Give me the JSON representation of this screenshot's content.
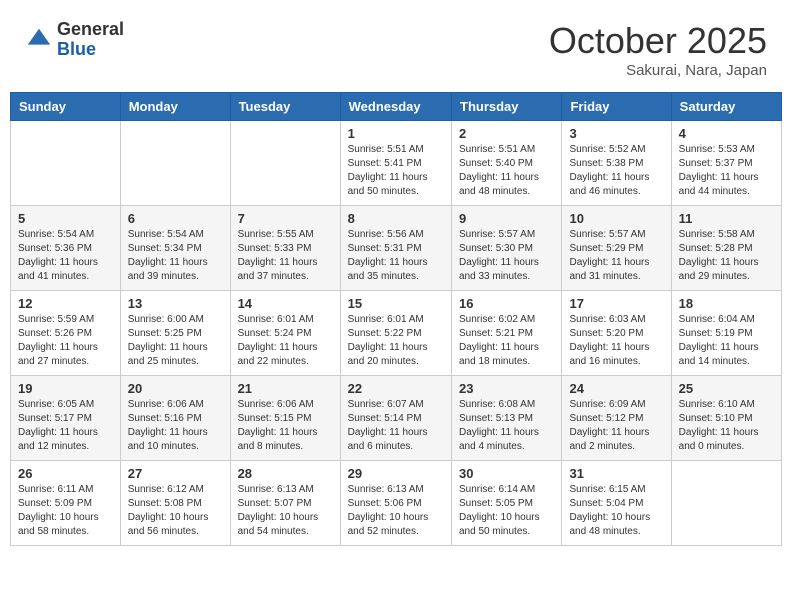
{
  "header": {
    "logo_general": "General",
    "logo_blue": "Blue",
    "month": "October 2025",
    "location": "Sakurai, Nara, Japan"
  },
  "days_of_week": [
    "Sunday",
    "Monday",
    "Tuesday",
    "Wednesday",
    "Thursday",
    "Friday",
    "Saturday"
  ],
  "weeks": [
    [
      {
        "day": "",
        "info": ""
      },
      {
        "day": "",
        "info": ""
      },
      {
        "day": "",
        "info": ""
      },
      {
        "day": "1",
        "info": "Sunrise: 5:51 AM\nSunset: 5:41 PM\nDaylight: 11 hours\nand 50 minutes."
      },
      {
        "day": "2",
        "info": "Sunrise: 5:51 AM\nSunset: 5:40 PM\nDaylight: 11 hours\nand 48 minutes."
      },
      {
        "day": "3",
        "info": "Sunrise: 5:52 AM\nSunset: 5:38 PM\nDaylight: 11 hours\nand 46 minutes."
      },
      {
        "day": "4",
        "info": "Sunrise: 5:53 AM\nSunset: 5:37 PM\nDaylight: 11 hours\nand 44 minutes."
      }
    ],
    [
      {
        "day": "5",
        "info": "Sunrise: 5:54 AM\nSunset: 5:36 PM\nDaylight: 11 hours\nand 41 minutes."
      },
      {
        "day": "6",
        "info": "Sunrise: 5:54 AM\nSunset: 5:34 PM\nDaylight: 11 hours\nand 39 minutes."
      },
      {
        "day": "7",
        "info": "Sunrise: 5:55 AM\nSunset: 5:33 PM\nDaylight: 11 hours\nand 37 minutes."
      },
      {
        "day": "8",
        "info": "Sunrise: 5:56 AM\nSunset: 5:31 PM\nDaylight: 11 hours\nand 35 minutes."
      },
      {
        "day": "9",
        "info": "Sunrise: 5:57 AM\nSunset: 5:30 PM\nDaylight: 11 hours\nand 33 minutes."
      },
      {
        "day": "10",
        "info": "Sunrise: 5:57 AM\nSunset: 5:29 PM\nDaylight: 11 hours\nand 31 minutes."
      },
      {
        "day": "11",
        "info": "Sunrise: 5:58 AM\nSunset: 5:28 PM\nDaylight: 11 hours\nand 29 minutes."
      }
    ],
    [
      {
        "day": "12",
        "info": "Sunrise: 5:59 AM\nSunset: 5:26 PM\nDaylight: 11 hours\nand 27 minutes."
      },
      {
        "day": "13",
        "info": "Sunrise: 6:00 AM\nSunset: 5:25 PM\nDaylight: 11 hours\nand 25 minutes."
      },
      {
        "day": "14",
        "info": "Sunrise: 6:01 AM\nSunset: 5:24 PM\nDaylight: 11 hours\nand 22 minutes."
      },
      {
        "day": "15",
        "info": "Sunrise: 6:01 AM\nSunset: 5:22 PM\nDaylight: 11 hours\nand 20 minutes."
      },
      {
        "day": "16",
        "info": "Sunrise: 6:02 AM\nSunset: 5:21 PM\nDaylight: 11 hours\nand 18 minutes."
      },
      {
        "day": "17",
        "info": "Sunrise: 6:03 AM\nSunset: 5:20 PM\nDaylight: 11 hours\nand 16 minutes."
      },
      {
        "day": "18",
        "info": "Sunrise: 6:04 AM\nSunset: 5:19 PM\nDaylight: 11 hours\nand 14 minutes."
      }
    ],
    [
      {
        "day": "19",
        "info": "Sunrise: 6:05 AM\nSunset: 5:17 PM\nDaylight: 11 hours\nand 12 minutes."
      },
      {
        "day": "20",
        "info": "Sunrise: 6:06 AM\nSunset: 5:16 PM\nDaylight: 11 hours\nand 10 minutes."
      },
      {
        "day": "21",
        "info": "Sunrise: 6:06 AM\nSunset: 5:15 PM\nDaylight: 11 hours\nand 8 minutes."
      },
      {
        "day": "22",
        "info": "Sunrise: 6:07 AM\nSunset: 5:14 PM\nDaylight: 11 hours\nand 6 minutes."
      },
      {
        "day": "23",
        "info": "Sunrise: 6:08 AM\nSunset: 5:13 PM\nDaylight: 11 hours\nand 4 minutes."
      },
      {
        "day": "24",
        "info": "Sunrise: 6:09 AM\nSunset: 5:12 PM\nDaylight: 11 hours\nand 2 minutes."
      },
      {
        "day": "25",
        "info": "Sunrise: 6:10 AM\nSunset: 5:10 PM\nDaylight: 11 hours\nand 0 minutes."
      }
    ],
    [
      {
        "day": "26",
        "info": "Sunrise: 6:11 AM\nSunset: 5:09 PM\nDaylight: 10 hours\nand 58 minutes."
      },
      {
        "day": "27",
        "info": "Sunrise: 6:12 AM\nSunset: 5:08 PM\nDaylight: 10 hours\nand 56 minutes."
      },
      {
        "day": "28",
        "info": "Sunrise: 6:13 AM\nSunset: 5:07 PM\nDaylight: 10 hours\nand 54 minutes."
      },
      {
        "day": "29",
        "info": "Sunrise: 6:13 AM\nSunset: 5:06 PM\nDaylight: 10 hours\nand 52 minutes."
      },
      {
        "day": "30",
        "info": "Sunrise: 6:14 AM\nSunset: 5:05 PM\nDaylight: 10 hours\nand 50 minutes."
      },
      {
        "day": "31",
        "info": "Sunrise: 6:15 AM\nSunset: 5:04 PM\nDaylight: 10 hours\nand 48 minutes."
      },
      {
        "day": "",
        "info": ""
      }
    ]
  ]
}
